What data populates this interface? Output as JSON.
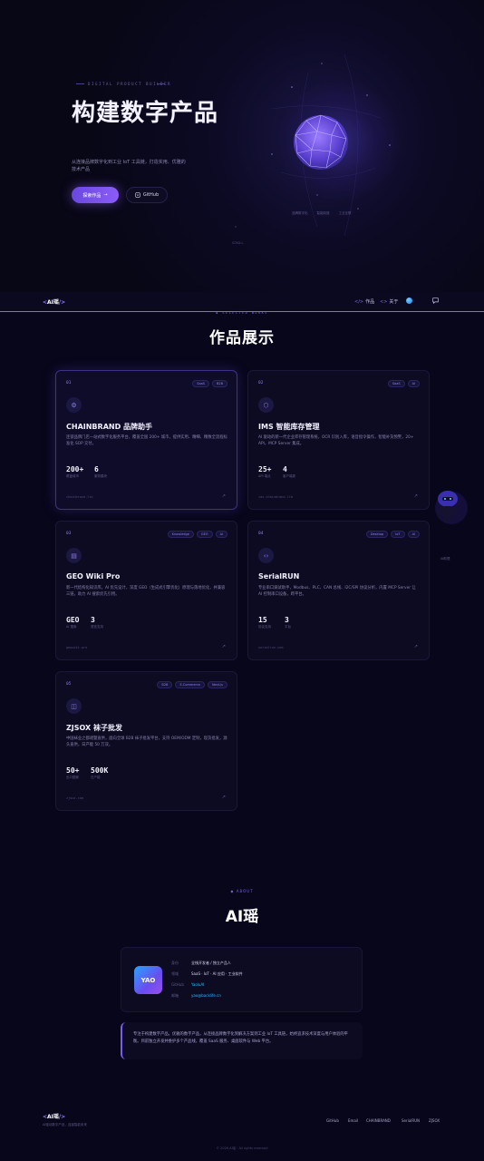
{
  "hero": {
    "kicker": "DIGITAL PRODUCT BUILDER",
    "title": "构建数字产品",
    "description": "从连接品牌数字化到工业 IoT 工具链，打造实用、优雅的技术产品",
    "primary_button": "探索作品",
    "primary_arrow": "→",
    "github_button": "GitHub",
    "tags": [
      "品牌数字化",
      "智能制造",
      "工业互联"
    ],
    "scroll_hint": "SCROLL"
  },
  "nav": {
    "logo_prefix": "<",
    "logo_text": "AI瑶",
    "logo_suffix": "/>",
    "works_icon": "</>",
    "works_label": "作品",
    "about_icon": "<>",
    "about_label": "关于"
  },
  "works": {
    "kicker": "◆ SELECTED WORKS",
    "title": "作品展示",
    "cards": [
      {
        "num": "01",
        "tags": [
          "SaaS",
          "B2B"
        ],
        "icon": "gear-icon",
        "title": "CHAINBRAND 品牌助手",
        "desc": "连锁品牌门店一站式数字化服务平台，覆盖全国 200+ 城市，提供实用、精细、精致全流程标准化 SOP 交付。",
        "stats": [
          {
            "v": "200+",
            "l": "覆盖城市"
          },
          {
            "v": "6",
            "l": "服务模块"
          }
        ],
        "url": "chainbrand.ltd"
      },
      {
        "num": "02",
        "tags": [
          "SaaS",
          "AI"
        ],
        "icon": "box-icon",
        "title": "IMS 智能库存管理",
        "desc": "AI 驱动的新一代企业库存管理系统，OCR 识别入库，语音指令操作，智能补货预警，20+ API，MCP Server 集成。",
        "stats": [
          {
            "v": "25+",
            "l": "API 端点"
          },
          {
            "v": "4",
            "l": "客户端类"
          }
        ],
        "url": "ims.chainbrand.ltd"
      },
      {
        "num": "03",
        "tags": [
          "Knowledge",
          "GEO",
          "AI"
        ],
        "icon": "book-icon",
        "title": "GEO Wiki Pro",
        "desc": "新一代结构化知识库，AI 优先设计，深度 GEO（生成式引擎优化）原理与落地优化，并兼容三链，助力 AI 搜索优先引用。",
        "stats": [
          {
            "v": "GEO",
            "l": "AI 搜索"
          },
          {
            "v": "3",
            "l": "语言支持"
          }
        ],
        "url": "geowiki.pro"
      },
      {
        "num": "04",
        "tags": [
          "Desktop",
          "IoT",
          "AI"
        ],
        "icon": "code-icon",
        "title": "SerialRUN",
        "desc": "专业串口调试助手，Modbus、PLC、CAN 总线、I2C/SPI 协议分析，内置 MCP Server 让 AI 控制串口设备，跨平台。",
        "stats": [
          {
            "v": "15",
            "l": "协议支持"
          },
          {
            "v": "3",
            "l": "平台"
          }
        ],
        "url": "serialrun.com"
      },
      {
        "num": "05",
        "tags": [
          "B2B",
          "E-Commerce",
          "Next.js"
        ],
        "icon": "bag-icon",
        "title": "ZJSOX 袜子批发",
        "desc": "中国袜业之都诸暨直供，面向全球 B2B 袜子批发平台，支持 OEM/ODM 定制，现货批发，源头直供，日产能 50 万双。",
        "stats": [
          {
            "v": "50+",
            "l": "出口国家"
          },
          {
            "v": "500K",
            "l": "日产能"
          }
        ],
        "url": "zjsox.com"
      }
    ]
  },
  "robot": {
    "label": "AI助理"
  },
  "about": {
    "kicker": "◆ ABOUT",
    "title": "AI瑶",
    "avatar_text": "YAO",
    "rows": [
      {
        "k": "身份",
        "v": "全栈开发者 / 独立产品人"
      },
      {
        "k": "领域",
        "v": "SaaS · IoT · AI 应用 · 工业软件"
      },
      {
        "k": "GitHub",
        "v": "YaoluAI"
      },
      {
        "k": "邮箱",
        "v": "yao@backlife.cn"
      }
    ],
    "quote": "专注于构建数字产品。优雅的数字产品，从连接品牌数字化到解决方案到工业 IoT 工具链，始终追求技术深度与用户体验的平衡。目前独立开发并维护多个产品线，覆盖 SaaS 服务、桌面软件与 Web 平台。"
  },
  "footer": {
    "logo_prefix": "<",
    "logo_text": "AI瑶",
    "logo_suffix": "/>",
    "tagline": "AI驱动数字产品，连接智能未来",
    "links": [
      "GitHub",
      "Email",
      "CHAINBRAND",
      "SerialRUN",
      "ZJSOX"
    ],
    "copyright": "© 2026 AI瑶 · All rights reserved"
  },
  "colors": {
    "accent": "#8b5cf6",
    "bg": "#07061a",
    "link": "#35b6ff"
  }
}
